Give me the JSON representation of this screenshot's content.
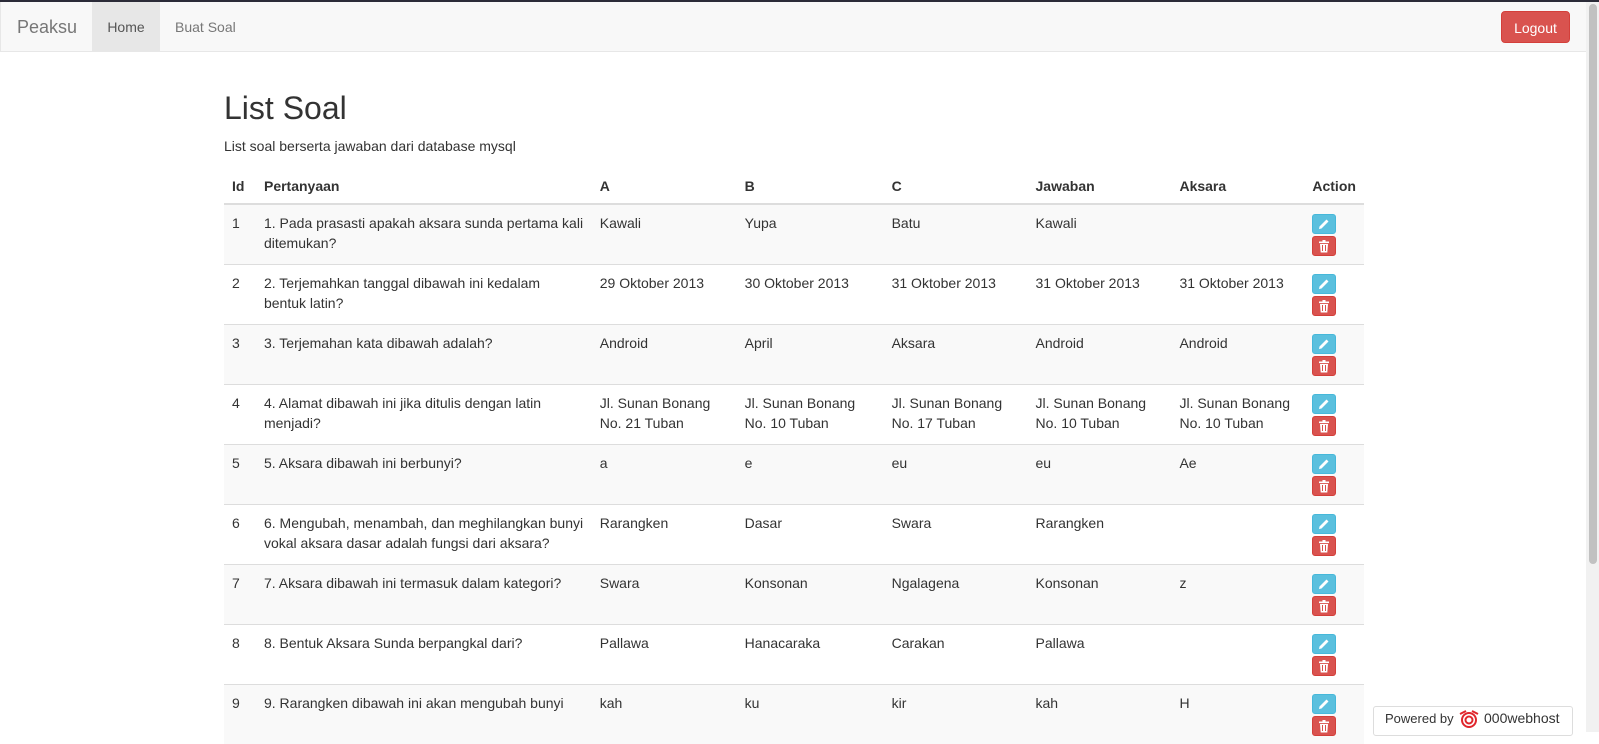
{
  "navbar": {
    "brand": "Peaksu",
    "home_label": "Home",
    "buat_soal_label": "Buat Soal",
    "logout_label": "Logout"
  },
  "page": {
    "title": "List Soal",
    "subtitle": "List soal berserta jawaban dari database mysql"
  },
  "table": {
    "headers": [
      "Id",
      "Pertanyaan",
      "A",
      "B",
      "C",
      "Jawaban",
      "Aksara",
      "Action"
    ],
    "rows": [
      {
        "id": "1",
        "pertanyaan": "1. Pada prasasti apakah aksara sunda pertama kali ditemukan?",
        "a": "Kawali",
        "b": "Yupa",
        "c": "Batu",
        "jawaban": "Kawali",
        "aksara": ""
      },
      {
        "id": "2",
        "pertanyaan": "2. Terjemahkan tanggal dibawah ini kedalam bentuk latin?",
        "a": "29 Oktober 2013",
        "b": "30 Oktober 2013",
        "c": "31 Oktober 2013",
        "jawaban": "31 Oktober 2013",
        "aksara": "31 Oktober 2013"
      },
      {
        "id": "3",
        "pertanyaan": "3. Terjemahan kata dibawah adalah?",
        "a": "Android",
        "b": "April",
        "c": "Aksara",
        "jawaban": "Android",
        "aksara": "Android"
      },
      {
        "id": "4",
        "pertanyaan": "4. Alamat dibawah ini jika ditulis dengan latin menjadi?",
        "a": "Jl. Sunan Bonang No. 21 Tuban",
        "b": "Jl. Sunan Bonang No. 10 Tuban",
        "c": "Jl. Sunan Bonang No. 17 Tuban",
        "jawaban": "Jl. Sunan Bonang No. 10 Tuban",
        "aksara": "Jl. Sunan Bonang No. 10 Tuban"
      },
      {
        "id": "5",
        "pertanyaan": "5. Aksara dibawah ini berbunyi?",
        "a": "a",
        "b": "e",
        "c": "eu",
        "jawaban": "eu",
        "aksara": "Ae"
      },
      {
        "id": "6",
        "pertanyaan": "6. Mengubah, menambah, dan meghilangkan bunyi vokal aksara dasar adalah fungsi dari aksara?",
        "a": "Rarangken",
        "b": "Dasar",
        "c": "Swara",
        "jawaban": "Rarangken",
        "aksara": ""
      },
      {
        "id": "7",
        "pertanyaan": "7. Aksara dibawah ini termasuk dalam kategori?",
        "a": "Swara",
        "b": "Konsonan",
        "c": "Ngalagena",
        "jawaban": "Konsonan",
        "aksara": "z"
      },
      {
        "id": "8",
        "pertanyaan": "8. Bentuk Aksara Sunda berpangkal dari?",
        "a": "Pallawa",
        "b": "Hanacaraka",
        "c": "Carakan",
        "jawaban": "Pallawa",
        "aksara": ""
      },
      {
        "id": "9",
        "pertanyaan": "9. Rarangken dibawah ini akan mengubah bunyi",
        "a": "kah",
        "b": "ku",
        "c": "kir",
        "jawaban": "kah",
        "aksara": "H"
      }
    ]
  },
  "badge": {
    "powered_label": "Powered by",
    "host_name": "000webhost"
  },
  "colors": {
    "navbar_bg": "#f8f8f8",
    "danger": "#d9534f",
    "info": "#5bc0de",
    "logo_red": "#e0262c"
  },
  "icons": {
    "edit": "pencil-icon",
    "delete": "trash-icon",
    "host_logo": "000webhost-logo-icon"
  }
}
